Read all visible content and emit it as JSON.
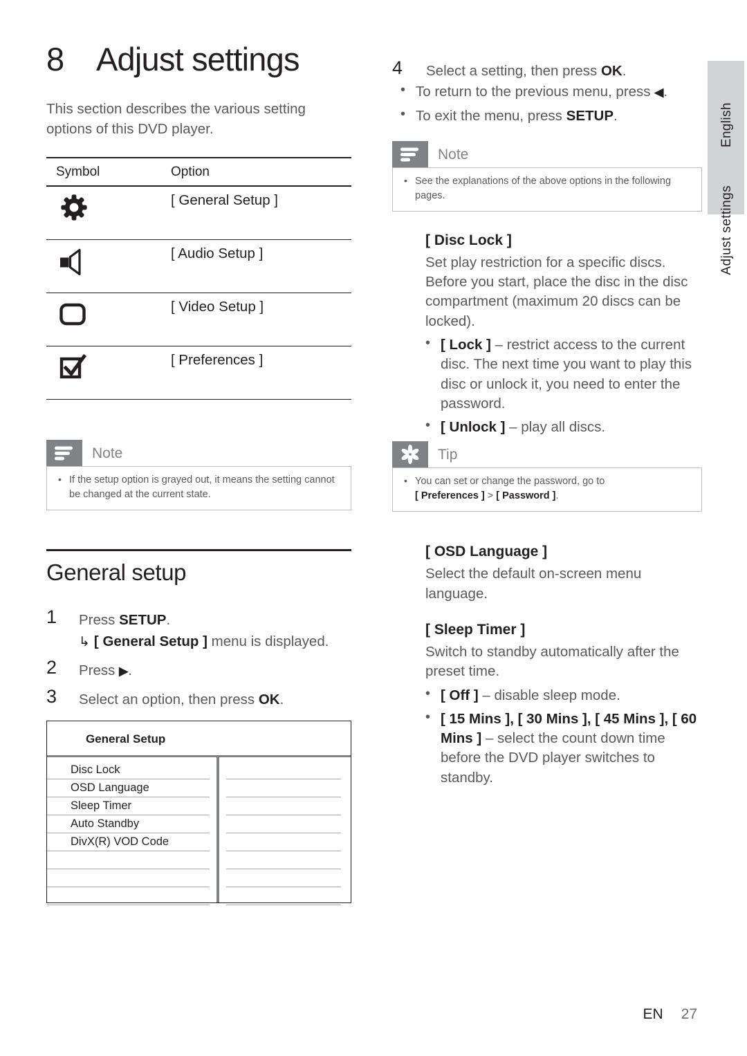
{
  "page": {
    "chapter_number": "8",
    "chapter_title": "Adjust settings",
    "intro": "This section describes the various setting options of this DVD player.",
    "footer_lang": "EN",
    "footer_page": "27"
  },
  "side_tabs": {
    "language": "English",
    "section": "Adjust settings"
  },
  "symbol_table": {
    "header_symbol": "Symbol",
    "header_option": "Option",
    "rows": [
      {
        "icon": "gear-icon",
        "option": "[ General Setup ]"
      },
      {
        "icon": "speaker-icon",
        "option": "[ Audio Setup ]"
      },
      {
        "icon": "video-screen-icon",
        "option": "[ Video Setup ]"
      },
      {
        "icon": "checkbox-check-icon",
        "option": "[ Preferences ]"
      }
    ]
  },
  "note_left": {
    "icon": "note-lines-icon",
    "label": "Note",
    "body": "If the setup option is grayed out, it means the setting cannot be changed at the current state."
  },
  "general_setup": {
    "section_title": "General setup",
    "steps": [
      {
        "num": "1",
        "text_a": "Press ",
        "bold": "SETUP",
        "text_b": ".",
        "sub_hook": "↳",
        "sub_bold": "[ General Setup ]",
        "sub_text": " menu is displayed."
      },
      {
        "num": "2",
        "text_a": "Press ",
        "glyph": "▶",
        "text_b": "."
      },
      {
        "num": "3",
        "text_a": "Select an option, then press ",
        "bold": "OK",
        "text_b": "."
      }
    ]
  },
  "osd_menu": {
    "title": "General Setup",
    "items": [
      "Disc Lock",
      "OSD Language",
      "Sleep Timer",
      "Auto Standby",
      "DivX(R) VOD Code"
    ],
    "blank_rows": 3,
    "right_rows": 8
  },
  "right_column": {
    "step4": {
      "num": "4",
      "text_a": "Select a setting, then press ",
      "bold": "OK",
      "text_b": ".",
      "bullets": [
        {
          "text_a": "To return to the previous menu, press ",
          "glyph": "◀",
          "text_b": "."
        },
        {
          "text_a": "To exit the menu, press ",
          "bold": "SETUP",
          "text_b": "."
        }
      ]
    },
    "note": {
      "icon": "note-lines-icon",
      "label": "Note",
      "body": "See the explanations of the above options in the following pages."
    },
    "disc_lock": {
      "heading": "[ Disc Lock ]",
      "paragraph": "Set play restriction for a specific discs. Before you start, place the disc in the disc compartment (maximum 20 discs can be locked).",
      "bullets": [
        {
          "bold": "[ Lock ]",
          "text": " – restrict access to the current disc. The next time you want to play this disc or unlock it, you need to enter the password."
        },
        {
          "bold": "[ Unlock ]",
          "text": " – play all discs."
        }
      ]
    },
    "tip": {
      "icon": "star-tip-icon",
      "label": "Tip",
      "body_a": "You can set or change the password, go to ",
      "body_bold1": "[ Preferences ]",
      "body_mid": " > ",
      "body_bold2": "[ Password ]",
      "body_end": "."
    },
    "osd_language": {
      "heading": "[ OSD Language ]",
      "paragraph": "Select the default on-screen menu language."
    },
    "sleep_timer": {
      "heading": "[ Sleep Timer ]",
      "paragraph": "Switch to standby automatically after the preset time.",
      "bullets": [
        {
          "bold": "[ Off ]",
          "text": " – disable sleep mode."
        },
        {
          "bold": "[ 15 Mins ], [ 30 Mins ], [ 45 Mins ], [ 60 Mins ]",
          "text": " – select the count down time before the DVD player switches to standby."
        }
      ]
    }
  },
  "colors": {
    "text_dark": "#231f20",
    "text_gray": "#58595b",
    "badge_gray": "#808285",
    "tab_gray": "#d1d3d4",
    "rule_gray": "#bcbec0"
  }
}
